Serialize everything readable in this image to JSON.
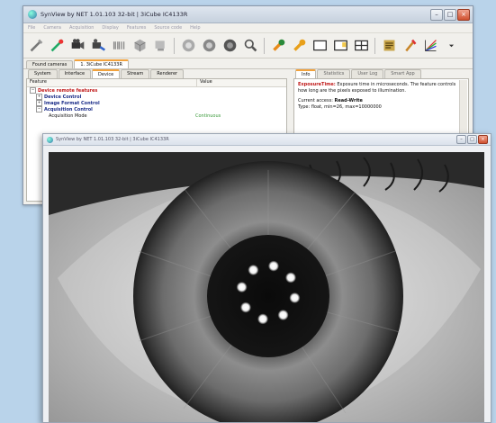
{
  "main_window": {
    "title": "SynView by NET 1.01.103 32-bit | 3iCube IC4133R",
    "controls": {
      "minimize": "–",
      "maximize": "□",
      "close": "×"
    }
  },
  "menu": [
    "File",
    "Camera",
    "Acquisition",
    "Display",
    "Features",
    "Source code",
    "Help"
  ],
  "toolbar_icons": [
    "tools-icon",
    "connect-icon",
    "camera-icon",
    "camera-settings-icon",
    "barcode-icon",
    "cube-icon",
    "snapshot-icon",
    "play-circle-icon",
    "pause-circle-icon",
    "record-icon",
    "zoom-icon",
    "wrench-icon",
    "wrench-alt-icon",
    "window-icon",
    "window-split-icon",
    "grid-icon",
    "text-icon",
    "pointer-icon",
    "color-chart-icon",
    "more-icon"
  ],
  "doc_tabs": [
    {
      "label": "Found cameras",
      "active": false
    },
    {
      "label": "1. 3iCube IC4133R",
      "active": true
    }
  ],
  "sub_tabs": [
    {
      "label": "System",
      "active": false
    },
    {
      "label": "Interface",
      "active": false
    },
    {
      "label": "Device",
      "active": true
    },
    {
      "label": "Stream",
      "active": false
    },
    {
      "label": "Renderer",
      "active": false
    }
  ],
  "tree": {
    "columns": [
      "Feature",
      "Value"
    ],
    "rows": [
      {
        "label": "Device remote features",
        "value": "",
        "kind": "root",
        "level": 0,
        "expander": "−"
      },
      {
        "label": "Device Control",
        "value": "",
        "kind": "node",
        "level": 1,
        "expander": "+"
      },
      {
        "label": "Image Format Control",
        "value": "",
        "kind": "node",
        "level": 1,
        "expander": "+"
      },
      {
        "label": "Acquisition Control",
        "value": "",
        "kind": "node",
        "level": 1,
        "expander": "−"
      },
      {
        "label": "Acquisition Mode",
        "value": "Continuous",
        "kind": "leaf",
        "level": 2,
        "expander": ""
      }
    ]
  },
  "info_tabs": [
    {
      "label": "Info",
      "active": true
    },
    {
      "label": "Statistics",
      "active": false
    },
    {
      "label": "User Log",
      "active": false
    },
    {
      "label": "Smart App",
      "active": false
    }
  ],
  "info": {
    "keyword": "ExposureTime:",
    "description": " Exposure time in microseconds. The feature controls how long are the pixels exposed to illumination.",
    "access_label": "Current access: ",
    "access_value": "Read-Write",
    "type_line": "Type: float, min=26, max=10000000"
  },
  "image_window": {
    "title": "SynView by NET 1.01.103 32-bit | 3iCube IC4133R",
    "controls": {
      "minimize": "–",
      "maximize": "□",
      "close": "×"
    }
  },
  "image": {
    "subject": "eye-image",
    "led_ring_count": 8
  }
}
